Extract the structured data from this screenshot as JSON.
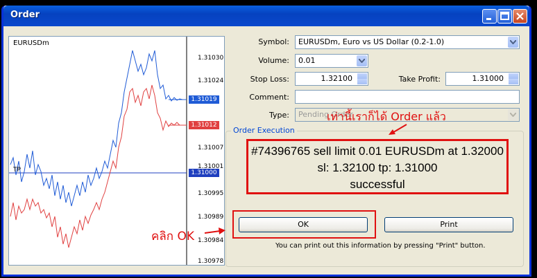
{
  "window": {
    "title": "Order"
  },
  "chart": {
    "symbol": "EURUSDm",
    "price_ticks": [
      "1.31030",
      "1.31024",
      "1.31019",
      "1.31012",
      "1.31007",
      "1.31001",
      "1.31000",
      "1.30995",
      "1.30989",
      "1.30984",
      "1.30978"
    ],
    "ask_tag": "1.31019",
    "bid_tag": "1.31012",
    "tp_tag": "1.31000",
    "tp_label": "TP",
    "colors": {
      "ask": "#1f5bd6",
      "bid": "#e04040",
      "tp": "#1f3fbf"
    }
  },
  "form": {
    "symbol_label": "Symbol:",
    "symbol_value": "EURUSDm, Euro vs US Dollar (0.2-1.0)",
    "volume_label": "Volume:",
    "volume_value": "0.01",
    "stoploss_label": "Stop Loss:",
    "stoploss_value": "1.32100",
    "takeprofit_label": "Take Profit:",
    "takeprofit_value": "1.31000",
    "comment_label": "Comment:",
    "comment_value": "",
    "type_label": "Type:",
    "type_value": "Pending Order"
  },
  "execution": {
    "group_title": "Order Execution",
    "line1": "#74396765 sell limit 0.01 EURUSDm at 1.32000",
    "line2": "sl: 1.32100 tp: 1.31000",
    "line3": "successful",
    "ok_label": "OK",
    "print_label": "Print",
    "info": "You can print out this information by pressing \"Print\" button."
  },
  "annotations": {
    "top_note": "เท่านี้เราก็ได้ Order แล้ว",
    "click_ok": "คลิก OK"
  }
}
